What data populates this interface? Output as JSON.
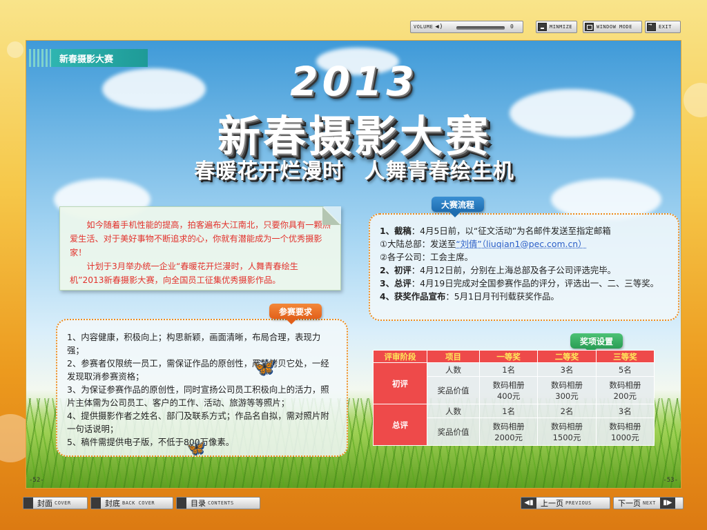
{
  "window": {
    "volume_label": "VOLUME",
    "volume_value": "0",
    "minimize_label": "MINMIZE",
    "window_mode_label": "WINDOW MODE",
    "exit_label": "EXIT"
  },
  "page": {
    "section_tab": "新春摄影大赛",
    "title_year": "2013",
    "title_main": "新春摄影大赛",
    "title_sub": "春暖花开烂漫时 人舞青春绘生机",
    "intro_p1": "如今随着手机性能的提高，拍客遍布大江南北，只要你具有一颗热爱生活、对于美好事物不断追求的心，你就有潜能成为一个优秀摄影家！",
    "intro_p2": "计划于3月举办统一企业“春暖花开烂漫时，人舞青春绘生机”2013新春摄影大赛，向全国员工征集优秀摄影作品。",
    "requirements_tag": "参赛要求",
    "requirements": [
      "1、内容健康，积极向上；构思新颖，画面清晰，布局合理，表现力强；",
      "2、参赛者仅限统一员工，需保证作品的原创性，严禁拷贝它处，一经发现取消参赛资格；",
      "3、为保证参赛作品的原创性，同时宣扬公司员工积极向上的活力，照片主体需为公司员工、客户的工作、活动、旅游等等照片；",
      "4、提供摄影作者之姓名、部门及联系方式；作品名自拟，需对照片附一句话说明；",
      "5、稿件需提供电子版，不低于800万像素。"
    ],
    "flow_tag": "大赛流程",
    "flow": {
      "l1_head": "1、截稿",
      "l1_text": "：4月5日前，以“征文活动”为名邮件发送至指定邮箱",
      "l2_prefix": "①大陆总部：发送至",
      "l2_link": "“刘倩”（liuqian1@pec.com.cn）",
      "l3": "②各子公司：工会主席。",
      "l4_head": "2、初评",
      "l4_text": "：4月12日前，分别在上海总部及各子公司评选完毕。",
      "l5_head": "3、总评",
      "l5_text": "：4月19日完成对全国参赛作品的评分，评选出一、二、三等奖。",
      "l6_head": "4、获奖作品宣布",
      "l6_text": "：5月1日月刊刊载获奖作品。"
    },
    "awards_tag": "奖项设置",
    "awards": {
      "headers": [
        "评审阶段",
        "项目",
        "一等奖",
        "二等奖",
        "三等奖"
      ],
      "stage1": "初评",
      "stage2": "总评",
      "count_label": "人数",
      "value_label": "奖品价值",
      "s1_counts": [
        "1名",
        "3名",
        "5名"
      ],
      "s1_values": [
        "数码相册\n400元",
        "数码相册\n300元",
        "数码相册\n200元"
      ],
      "s2_counts": [
        "1名",
        "2名",
        "3名"
      ],
      "s2_values": [
        "数码相册\n2000元",
        "数码相册\n1500元",
        "数码相册\n1000元"
      ]
    },
    "page_left": "-52-",
    "page_right": "-53-"
  },
  "nav": {
    "cover_cn": "封面",
    "cover_en": "COVER",
    "back_cn": "封底",
    "back_en": "BACK COVER",
    "contents_cn": "目录",
    "contents_en": "CONTENTS",
    "prev_cn": "上一页",
    "prev_en": "PREVIOUS",
    "next_cn": "下一页",
    "next_en": "NEXT"
  }
}
